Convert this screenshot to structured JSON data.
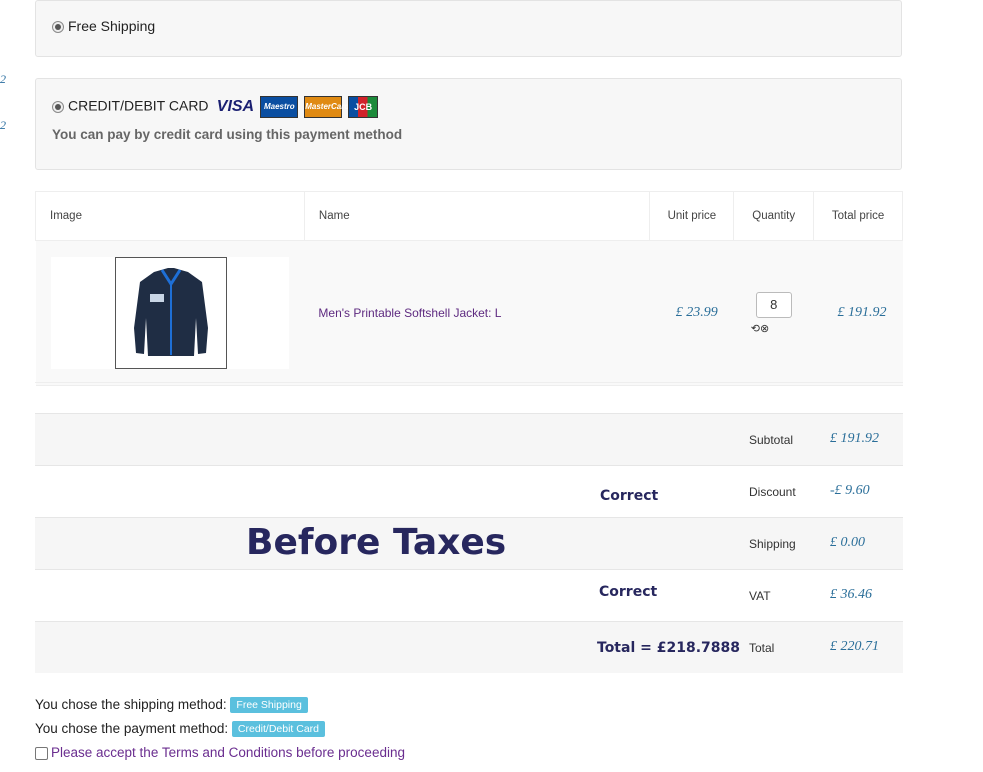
{
  "edge_numbers": [
    "2",
    "2"
  ],
  "shipping": {
    "label": "Free Shipping"
  },
  "payment": {
    "label": "CREDIT/DEBIT CARD",
    "description": "You can pay by credit card using this payment method",
    "cards": [
      "VISA",
      "Maestro",
      "MasterCard",
      "JCB"
    ]
  },
  "cart": {
    "headers": {
      "image": "Image",
      "name": "Name",
      "unit_price": "Unit price",
      "quantity": "Quantity",
      "total_price": "Total price"
    },
    "items": [
      {
        "name": "Men's Printable Softshell Jacket: L",
        "unit_price": "£ 23.99",
        "quantity": "8",
        "total_price": "£ 191.92",
        "icon": "jacket-image"
      }
    ]
  },
  "totals": {
    "subtotal": {
      "label": "Subtotal",
      "value": "£ 191.92"
    },
    "discount": {
      "label": "Discount",
      "value": "-£ 9.60"
    },
    "shipping": {
      "label": "Shipping",
      "value": "£ 0.00"
    },
    "vat": {
      "label": "VAT",
      "value": "£ 36.46"
    },
    "total": {
      "label": "Total",
      "value": "£ 220.71"
    }
  },
  "annotations": {
    "correct_1": "Correct",
    "before_taxes": "Before Taxes",
    "correct_2": "Correct",
    "computed_total": "Total = £218.7888"
  },
  "summary": {
    "shipping_prefix": "You chose the shipping method:",
    "shipping_value": "Free Shipping",
    "payment_prefix": "You chose the payment method:",
    "payment_value": "Credit/Debit Card",
    "terms": "Please accept the Terms and Conditions before proceeding"
  }
}
